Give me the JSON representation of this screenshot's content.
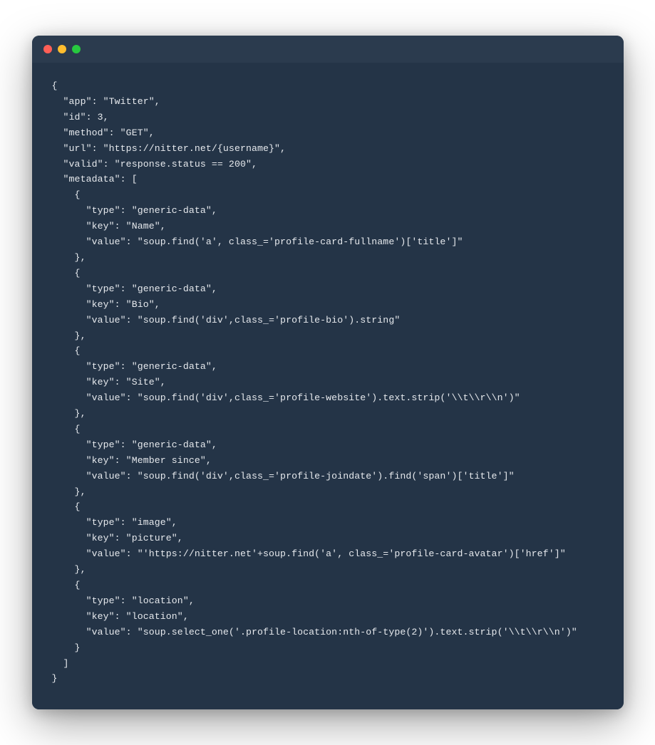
{
  "colors": {
    "window_bg": "#2b3b4e",
    "code_bg": "#243447",
    "text": "#e6e9ed",
    "dot_red": "#ff5f56",
    "dot_yellow": "#ffbd2e",
    "dot_green": "#27c93f"
  },
  "code_lines": [
    "{",
    "  \"app\": \"Twitter\",",
    "  \"id\": 3,",
    "  \"method\": \"GET\",",
    "  \"url\": \"https://nitter.net/{username}\",",
    "  \"valid\": \"response.status == 200\",",
    "  \"metadata\": [",
    "    {",
    "      \"type\": \"generic-data\",",
    "      \"key\": \"Name\",",
    "      \"value\": \"soup.find('a', class_='profile-card-fullname')['title']\"",
    "    },",
    "    {",
    "      \"type\": \"generic-data\",",
    "      \"key\": \"Bio\",",
    "      \"value\": \"soup.find('div',class_='profile-bio').string\"",
    "    },",
    "    {",
    "      \"type\": \"generic-data\",",
    "      \"key\": \"Site\",",
    "      \"value\": \"soup.find('div',class_='profile-website').text.strip('\\\\t\\\\r\\\\n')\"",
    "    },",
    "    {",
    "      \"type\": \"generic-data\",",
    "      \"key\": \"Member since\",",
    "      \"value\": \"soup.find('div',class_='profile-joindate').find('span')['title']\"",
    "    },",
    "    {",
    "      \"type\": \"image\",",
    "      \"key\": \"picture\",",
    "      \"value\": \"'https://nitter.net'+soup.find('a', class_='profile-card-avatar')['href']\"",
    "    },",
    "    {",
    "      \"type\": \"location\",",
    "      \"key\": \"location\",",
    "      \"value\": \"soup.select_one('.profile-location:nth-of-type(2)').text.strip('\\\\t\\\\r\\\\n')\"",
    "    }",
    "  ]",
    "}"
  ]
}
